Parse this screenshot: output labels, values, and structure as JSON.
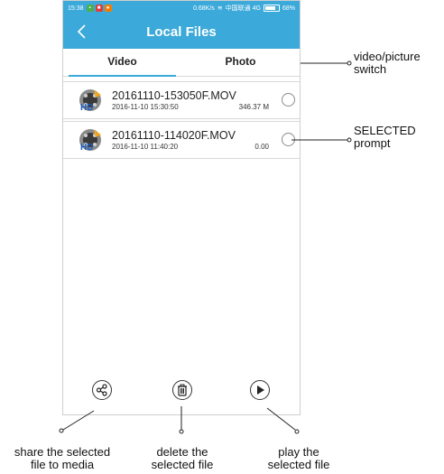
{
  "status_bar": {
    "time": "15:38",
    "speed": "0.68K/s",
    "carrier": "中国联通 4G",
    "battery": "68%"
  },
  "header": {
    "title": "Local Files"
  },
  "tabs": [
    {
      "label": "Video",
      "active": true
    },
    {
      "label": "Photo",
      "active": false
    }
  ],
  "files": [
    {
      "name": "20161110-153050F.MOV",
      "datetime": "2016-11-10 15:30:50",
      "size": "346.37 M",
      "icon": "hd-video-icon"
    },
    {
      "name": "20161110-114020F.MOV",
      "datetime": "2016-11-10 11:40:20",
      "size": "0.00",
      "icon": "hd-video-icon"
    }
  ],
  "bottom_actions": [
    {
      "icon": "share-icon"
    },
    {
      "icon": "trash-icon"
    },
    {
      "icon": "play-icon"
    }
  ],
  "annotations": {
    "switch": [
      "video/picture",
      "switch"
    ],
    "selected": [
      "SELECTED",
      "prompt"
    ],
    "share": [
      "share the selected",
      "file to media"
    ],
    "delete": [
      "delete the",
      "selected file"
    ],
    "play": [
      "play the",
      "selected file"
    ]
  },
  "colors": {
    "accent": "#3ba9d9"
  }
}
